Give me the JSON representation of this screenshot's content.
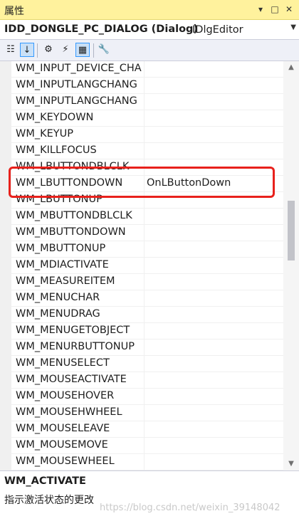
{
  "window": {
    "title": "属性",
    "controls": [
      "▾",
      "□",
      "✕"
    ]
  },
  "object_selector": {
    "name": "IDD_DONGLE_PC_DIALOG (Dialog)",
    "type": "IDlgEditor",
    "dropdown_icon": "dropdown-arrow-icon"
  },
  "toolbar": {
    "items": [
      {
        "name": "categorized-icon",
        "glyph": "☷",
        "active": false
      },
      {
        "name": "alphabetical-icon",
        "glyph": "↓",
        "active": true
      },
      {
        "name": "properties-icon",
        "glyph": "⚙",
        "active": false
      },
      {
        "name": "events-icon",
        "glyph": "⚡",
        "active": false
      },
      {
        "name": "messages-icon",
        "glyph": "▦",
        "active": true
      },
      {
        "name": "overrides-icon",
        "glyph": "🔧",
        "active": false
      }
    ]
  },
  "grid": {
    "rows": [
      {
        "name": "WM_INPUT_DEVICE_CHA",
        "value": ""
      },
      {
        "name": "WM_INPUTLANGCHANG",
        "value": ""
      },
      {
        "name": "WM_INPUTLANGCHANG",
        "value": ""
      },
      {
        "name": "WM_KEYDOWN",
        "value": ""
      },
      {
        "name": "WM_KEYUP",
        "value": ""
      },
      {
        "name": "WM_KILLFOCUS",
        "value": ""
      },
      {
        "name": "WM_LBUTTONDBLCLK",
        "value": ""
      },
      {
        "name": "WM_LBUTTONDOWN",
        "value": "OnLButtonDown"
      },
      {
        "name": "WM_LBUTTONUP",
        "value": ""
      },
      {
        "name": "WM_MBUTTONDBLCLK",
        "value": ""
      },
      {
        "name": "WM_MBUTTONDOWN",
        "value": ""
      },
      {
        "name": "WM_MBUTTONUP",
        "value": ""
      },
      {
        "name": "WM_MDIACTIVATE",
        "value": ""
      },
      {
        "name": "WM_MEASUREITEM",
        "value": ""
      },
      {
        "name": "WM_MENUCHAR",
        "value": ""
      },
      {
        "name": "WM_MENUDRAG",
        "value": ""
      },
      {
        "name": "WM_MENUGETOBJECT",
        "value": ""
      },
      {
        "name": "WM_MENURBUTTONUP",
        "value": ""
      },
      {
        "name": "WM_MENUSELECT",
        "value": ""
      },
      {
        "name": "WM_MOUSEACTIVATE",
        "value": ""
      },
      {
        "name": "WM_MOUSEHOVER",
        "value": ""
      },
      {
        "name": "WM_MOUSEHWHEEL",
        "value": ""
      },
      {
        "name": "WM_MOUSELEAVE",
        "value": ""
      },
      {
        "name": "WM_MOUSEMOVE",
        "value": ""
      },
      {
        "name": "WM_MOUSEWHEEL",
        "value": ""
      }
    ]
  },
  "description": {
    "title": "WM_ACTIVATE",
    "text": "指示激活状态的更改",
    "watermark": "https://blog.csdn.net/weixin_39148042"
  },
  "colors": {
    "titlebar": "#fff29d",
    "highlight": "#e8211c"
  }
}
